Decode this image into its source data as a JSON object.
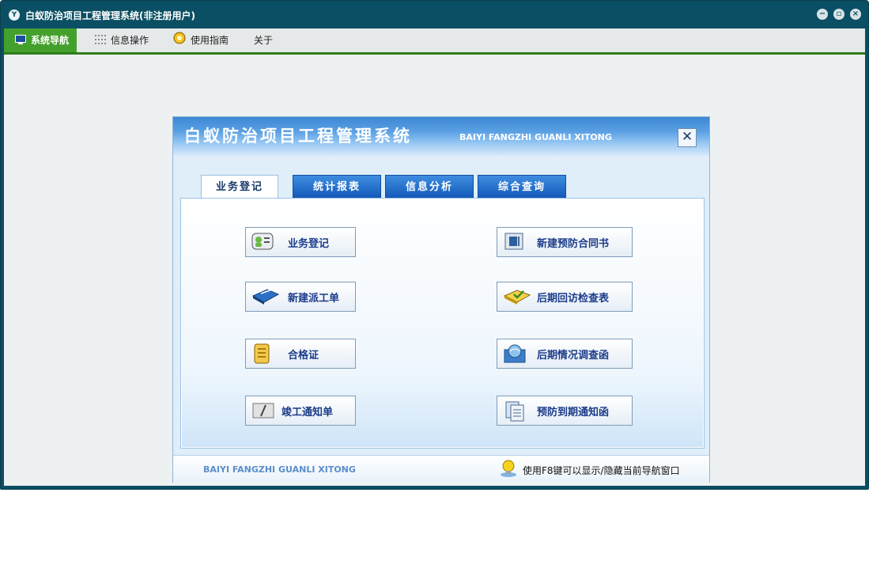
{
  "window": {
    "title": "白蚁防治项目工程管理系统(非注册用户)",
    "app_icon": "y-logo-icon",
    "controls": [
      "minimize-icon",
      "restore-icon",
      "close-icon"
    ]
  },
  "menubar": {
    "items": [
      {
        "label": "系统导航",
        "icon": "monitor-icon",
        "active": true
      },
      {
        "label": "信息操作",
        "icon": "grid-icon",
        "active": false
      },
      {
        "label": "使用指南",
        "icon": "guide-bulb-icon",
        "active": false
      },
      {
        "label": "关于",
        "icon": "",
        "active": false
      }
    ]
  },
  "nav": {
    "title": "白蚁防治项目工程管理系统",
    "subtitle": "BAIYI FANGZHI GUANLI XITONG",
    "tabs": [
      {
        "label": "业务登记",
        "active": true
      },
      {
        "label": "统计报表",
        "active": false
      },
      {
        "label": "信息分析",
        "active": false
      },
      {
        "label": "综合查询",
        "active": false
      }
    ],
    "buttons": [
      {
        "label": "业务登记",
        "icon": "user-card-icon"
      },
      {
        "label": "新建预防合同书",
        "icon": "contract-icon"
      },
      {
        "label": "新建派工单",
        "icon": "book-icon"
      },
      {
        "label": "后期回访检查表",
        "icon": "checklist-icon"
      },
      {
        "label": "合格证",
        "icon": "certificate-icon"
      },
      {
        "label": "后期情况调查函",
        "icon": "globe-letter-icon"
      },
      {
        "label": "竣工通知单",
        "icon": "notice-pen-icon"
      },
      {
        "label": "预防到期通知函",
        "icon": "documents-icon"
      }
    ],
    "footer": {
      "brand": "BAIYI FANGZHI GUANLI XITONG",
      "hint": "使用F8键可以显示/隐藏当前导航窗口"
    }
  },
  "colors": {
    "window_frame": "#0a4f63",
    "menu_active": "#43a02d",
    "tab_blue": "#1258b8",
    "button_text": "#1b3c8a"
  }
}
